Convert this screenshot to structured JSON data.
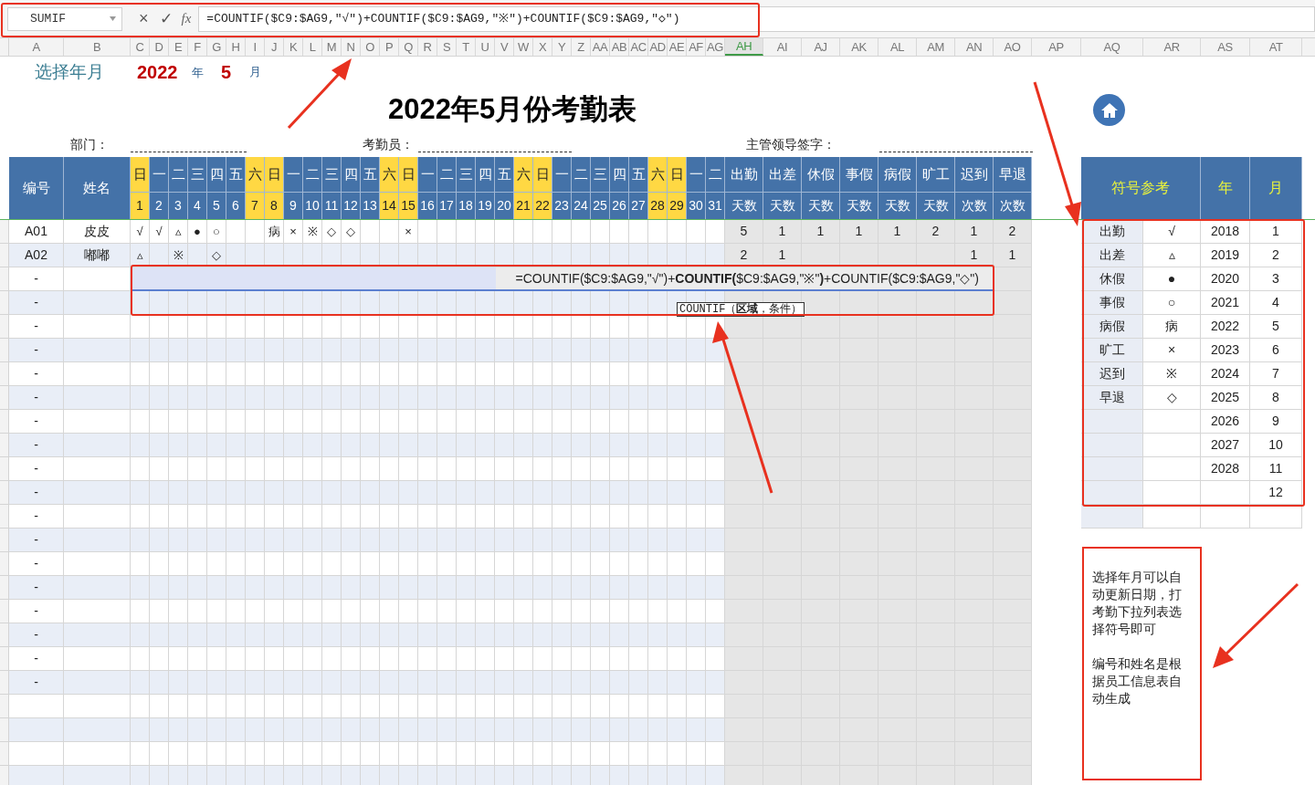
{
  "formula_bar": {
    "name_box": "SUMIF",
    "cancel": "×",
    "confirm": "✓",
    "fx": "fx",
    "formula": "=COUNTIF($C9:$AG9,″√″)+COUNTIF($C9:$AG9,″※″)+COUNTIF($C9:$AG9,″◇″)"
  },
  "columns": [
    {
      "label": "A",
      "selected": false
    },
    {
      "label": "B",
      "selected": false
    },
    {
      "label": "C",
      "selected": false
    },
    {
      "label": "D",
      "selected": false
    },
    {
      "label": "E",
      "selected": false
    },
    {
      "label": "F",
      "selected": false
    },
    {
      "label": "G",
      "selected": false
    },
    {
      "label": "H",
      "selected": false
    },
    {
      "label": "I",
      "selected": false
    },
    {
      "label": "J",
      "selected": false
    },
    {
      "label": "K",
      "selected": false
    },
    {
      "label": "L",
      "selected": false
    },
    {
      "label": "M",
      "selected": false
    },
    {
      "label": "N",
      "selected": false
    },
    {
      "label": "O",
      "selected": false
    },
    {
      "label": "P",
      "selected": false
    },
    {
      "label": "Q",
      "selected": false
    },
    {
      "label": "R",
      "selected": false
    },
    {
      "label": "S",
      "selected": false
    },
    {
      "label": "T",
      "selected": false
    },
    {
      "label": "U",
      "selected": false
    },
    {
      "label": "V",
      "selected": false
    },
    {
      "label": "W",
      "selected": false
    },
    {
      "label": "X",
      "selected": false
    },
    {
      "label": "Y",
      "selected": false
    },
    {
      "label": "Z",
      "selected": false
    },
    {
      "label": "AA",
      "selected": false
    },
    {
      "label": "AB",
      "selected": false
    },
    {
      "label": "AC",
      "selected": false
    },
    {
      "label": "AD",
      "selected": false
    },
    {
      "label": "AE",
      "selected": false
    },
    {
      "label": "AF",
      "selected": false
    },
    {
      "label": "AG",
      "selected": false
    },
    {
      "label": "AH",
      "selected": true
    },
    {
      "label": "AI",
      "selected": false
    },
    {
      "label": "AJ",
      "selected": false
    },
    {
      "label": "AK",
      "selected": false
    },
    {
      "label": "AL",
      "selected": false
    },
    {
      "label": "AM",
      "selected": false
    },
    {
      "label": "AN",
      "selected": false
    },
    {
      "label": "AO",
      "selected": false
    },
    {
      "label": "AP",
      "selected": false
    },
    {
      "label": "AQ",
      "selected": false
    },
    {
      "label": "AR",
      "selected": false
    },
    {
      "label": "AS",
      "selected": false
    },
    {
      "label": "AT",
      "selected": false
    }
  ],
  "selector": {
    "label": "选择年月",
    "year": "2022",
    "year_unit": "年",
    "month": "5",
    "month_unit": "月"
  },
  "title": "2022年5月份考勤表",
  "signatures": [
    {
      "label": "部门："
    },
    {
      "label": "考勤员："
    },
    {
      "label": "主管领导签字："
    }
  ],
  "table": {
    "id_header": "编号",
    "name_header": "姓名",
    "days": [
      {
        "weekday": "日",
        "date": "1",
        "weekend": true
      },
      {
        "weekday": "一",
        "date": "2",
        "weekend": false
      },
      {
        "weekday": "二",
        "date": "3",
        "weekend": false
      },
      {
        "weekday": "三",
        "date": "4",
        "weekend": false
      },
      {
        "weekday": "四",
        "date": "5",
        "weekend": false
      },
      {
        "weekday": "五",
        "date": "6",
        "weekend": false
      },
      {
        "weekday": "六",
        "date": "7",
        "weekend": true
      },
      {
        "weekday": "日",
        "date": "8",
        "weekend": true
      },
      {
        "weekday": "一",
        "date": "9",
        "weekend": false
      },
      {
        "weekday": "二",
        "date": "10",
        "weekend": false
      },
      {
        "weekday": "三",
        "date": "11",
        "weekend": false
      },
      {
        "weekday": "四",
        "date": "12",
        "weekend": false
      },
      {
        "weekday": "五",
        "date": "13",
        "weekend": false
      },
      {
        "weekday": "六",
        "date": "14",
        "weekend": true
      },
      {
        "weekday": "日",
        "date": "15",
        "weekend": true
      },
      {
        "weekday": "一",
        "date": "16",
        "weekend": false
      },
      {
        "weekday": "二",
        "date": "17",
        "weekend": false
      },
      {
        "weekday": "三",
        "date": "18",
        "weekend": false
      },
      {
        "weekday": "四",
        "date": "19",
        "weekend": false
      },
      {
        "weekday": "五",
        "date": "20",
        "weekend": false
      },
      {
        "weekday": "六",
        "date": "21",
        "weekend": true
      },
      {
        "weekday": "日",
        "date": "22",
        "weekend": true
      },
      {
        "weekday": "一",
        "date": "23",
        "weekend": false
      },
      {
        "weekday": "二",
        "date": "24",
        "weekend": false
      },
      {
        "weekday": "三",
        "date": "25",
        "weekend": false
      },
      {
        "weekday": "四",
        "date": "26",
        "weekend": false
      },
      {
        "weekday": "五",
        "date": "27",
        "weekend": false
      },
      {
        "weekday": "六",
        "date": "28",
        "weekend": true
      },
      {
        "weekday": "日",
        "date": "29",
        "weekend": true
      },
      {
        "weekday": "一",
        "date": "30",
        "weekend": false
      },
      {
        "weekday": "二",
        "date": "31",
        "weekend": false
      }
    ],
    "summary_headers": [
      {
        "top": "出勤",
        "bottom": "天数"
      },
      {
        "top": "出差",
        "bottom": "天数"
      },
      {
        "top": "休假",
        "bottom": "天数"
      },
      {
        "top": "事假",
        "bottom": "天数"
      },
      {
        "top": "病假",
        "bottom": "天数"
      },
      {
        "top": "旷工",
        "bottom": "天数"
      },
      {
        "top": "迟到",
        "bottom": "次数"
      },
      {
        "top": "早退",
        "bottom": "次数"
      }
    ],
    "rows": [
      {
        "id": "A01",
        "name": "皮皮",
        "marks": [
          {
            "kind": "symbol",
            "symbol": "√"
          },
          {
            "kind": "symbol",
            "symbol": "√"
          },
          {
            "kind": "symbol",
            "symbol": "▵"
          },
          {
            "kind": "symbol",
            "symbol": "●"
          },
          {
            "kind": "symbol",
            "symbol": "○"
          },
          {
            "kind": "blank"
          },
          {
            "kind": "blank"
          },
          {
            "kind": "symbol",
            "symbol": "病"
          },
          {
            "kind": "symbol",
            "symbol": "×"
          },
          {
            "kind": "symbol",
            "symbol": "※"
          },
          {
            "kind": "symbol",
            "symbol": "◇"
          },
          {
            "kind": "symbol",
            "symbol": "◇"
          },
          {
            "kind": "blank"
          },
          {
            "kind": "blank"
          },
          {
            "kind": "symbol",
            "symbol": "×"
          }
        ],
        "summary": [
          {
            "kind": "value",
            "value": "5"
          },
          {
            "kind": "value",
            "value": "1"
          },
          {
            "kind": "value",
            "value": "1"
          },
          {
            "kind": "value",
            "value": "1"
          },
          {
            "kind": "value",
            "value": "1"
          },
          {
            "kind": "value",
            "value": "2"
          },
          {
            "kind": "value",
            "value": "1"
          },
          {
            "kind": "value",
            "value": "2"
          }
        ]
      },
      {
        "id": "A02",
        "name": "嘟嘟",
        "marks": [
          {
            "kind": "symbol",
            "symbol": "▵"
          },
          {
            "kind": "blank"
          },
          {
            "kind": "symbol",
            "symbol": "※"
          },
          {
            "kind": "blank"
          },
          {
            "kind": "symbol",
            "symbol": "◇"
          }
        ],
        "summary": [
          {
            "kind": "value",
            "value": "2"
          },
          {
            "kind": "value",
            "value": "1"
          },
          {
            "kind": "blank"
          },
          {
            "kind": "blank"
          },
          {
            "kind": "blank"
          },
          {
            "kind": "blank"
          },
          {
            "kind": "value",
            "value": "1"
          },
          {
            "kind": "value",
            "value": "1"
          }
        ]
      },
      {
        "id": "-"
      },
      {
        "id": "-"
      },
      {
        "id": "-"
      },
      {
        "id": "-"
      },
      {
        "id": "-"
      },
      {
        "id": "-"
      },
      {
        "id": "-"
      },
      {
        "id": "-"
      },
      {
        "id": "-"
      },
      {
        "id": "-"
      },
      {
        "id": "-"
      },
      {
        "id": "-"
      },
      {
        "id": "-"
      },
      {
        "id": "-"
      },
      {
        "id": "-"
      },
      {
        "id": "-"
      },
      {
        "id": "-"
      },
      {
        "id": "-"
      }
    ]
  },
  "cell_editor": {
    "formula": "=COUNTIF($C9:$AG9,\"√\")+**COUNTIF(**$C9:$AG9,\"※\"**)**+COUNTIF($C9:$AG9,\"◇\")",
    "tooltip": "COUNTIF（**区域**，条件）"
  },
  "reference": {
    "header": "符号参考",
    "year_header": "年",
    "month_header": "月",
    "rows": [
      {
        "type": "出勤",
        "symbol": "√",
        "year": "2018",
        "month": "1"
      },
      {
        "type": "出差",
        "symbol": "▵",
        "year": "2019",
        "month": "2"
      },
      {
        "type": "休假",
        "symbol": "●",
        "year": "2020",
        "month": "3"
      },
      {
        "type": "事假",
        "symbol": "○",
        "year": "2021",
        "month": "4"
      },
      {
        "type": "病假",
        "symbol": "病",
        "year": "2022",
        "month": "5"
      },
      {
        "type": "旷工",
        "symbol": "×",
        "year": "2023",
        "month": "6"
      },
      {
        "type": "迟到",
        "symbol": "※",
        "year": "2024",
        "month": "7"
      },
      {
        "type": "早退",
        "symbol": "◇",
        "year": "2025",
        "month": "8"
      },
      {
        "year": "2026",
        "month": "9"
      },
      {
        "year": "2027",
        "month": "10"
      },
      {
        "year": "2028",
        "month": "11"
      },
      {
        "month": "12"
      }
    ]
  },
  "note": [
    "选择年月可以自动更新日期，打考勤下拉列表选择符号即可",
    "编号和姓名是根据员工信息表自动生成"
  ]
}
